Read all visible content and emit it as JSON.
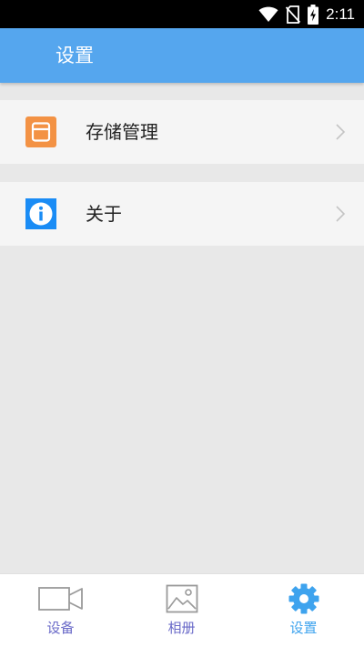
{
  "status_bar": {
    "time": "2:11",
    "icons": [
      "wifi-icon",
      "no-sim-icon",
      "battery-charging-icon"
    ]
  },
  "header": {
    "title": "设置"
  },
  "settings_list": [
    {
      "label": "存储管理",
      "icon": "storage-icon",
      "icon_color": "#f39244"
    },
    {
      "label": "关于",
      "icon": "info-icon",
      "icon_color": "#1a8cf5"
    }
  ],
  "bottom_nav": {
    "items": [
      {
        "label": "设备",
        "icon": "video-camera-icon",
        "active": false
      },
      {
        "label": "相册",
        "icon": "image-icon",
        "active": false
      },
      {
        "label": "设置",
        "icon": "gear-icon",
        "active": true
      }
    ],
    "active_color": "#3ea3ee",
    "inactive_label_color": "#6a6ac8",
    "inactive_icon_color": "#9a9a9a"
  },
  "colors": {
    "app_bar": "#55a6ee",
    "background": "#e8e8e8",
    "row_background": "#f5f5f5"
  }
}
